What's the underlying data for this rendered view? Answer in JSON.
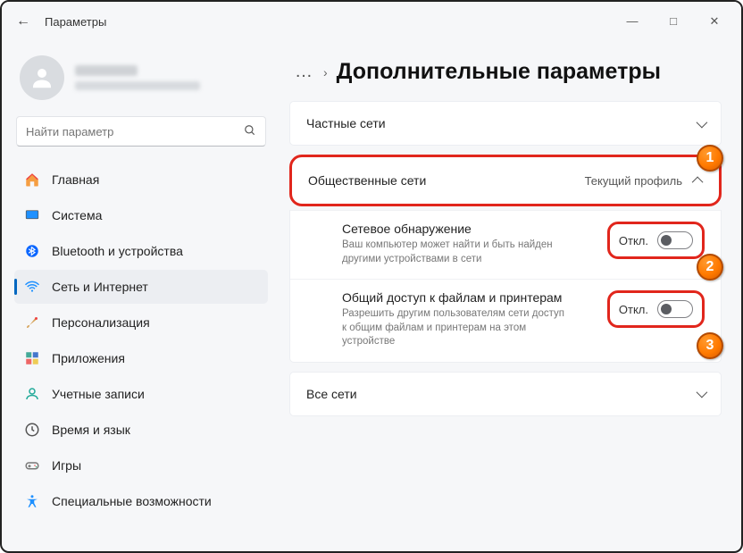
{
  "window": {
    "title": "Параметры"
  },
  "search": {
    "placeholder": "Найти параметр"
  },
  "sidebar": {
    "items": [
      {
        "label": "Главная",
        "icon": "home"
      },
      {
        "label": "Система",
        "icon": "system"
      },
      {
        "label": "Bluetooth и устройства",
        "icon": "bluetooth"
      },
      {
        "label": "Сеть и Интернет",
        "icon": "wifi",
        "active": true
      },
      {
        "label": "Персонализация",
        "icon": "brush"
      },
      {
        "label": "Приложения",
        "icon": "apps"
      },
      {
        "label": "Учетные записи",
        "icon": "person"
      },
      {
        "label": "Время и язык",
        "icon": "clock"
      },
      {
        "label": "Игры",
        "icon": "gamepad"
      },
      {
        "label": "Специальные возможности",
        "icon": "accessibility"
      }
    ]
  },
  "breadcrumb": {
    "dots": "…",
    "title": "Дополнительные параметры"
  },
  "sections": {
    "private": {
      "title": "Частные сети"
    },
    "public": {
      "title": "Общественные сети",
      "badge": "Текущий профиль",
      "rows": [
        {
          "title": "Сетевое обнаружение",
          "desc": "Ваш компьютер может найти и быть найден другими устройствами в сети",
          "state": "Откл."
        },
        {
          "title": "Общий доступ к файлам и принтерам",
          "desc": "Разрешить другим пользователям сети доступ к общим файлам и принтерам на этом устройстве",
          "state": "Откл."
        }
      ]
    },
    "all": {
      "title": "Все сети"
    }
  },
  "markers": [
    "1",
    "2",
    "3"
  ]
}
